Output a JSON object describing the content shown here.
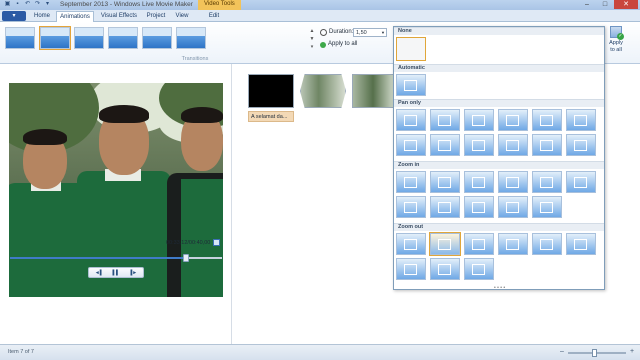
{
  "window": {
    "title": "September 2013 - Windows Live Movie Maker",
    "contextual_group": "Video Tools",
    "controls": {
      "minimize": "–",
      "maximize": "□",
      "close": "✕"
    }
  },
  "quick_access": [
    "save-icon",
    "undo-icon",
    "redo-icon"
  ],
  "tabs": {
    "file": "▾",
    "items": [
      "Home",
      "Animations",
      "Visual Effects",
      "Project",
      "View",
      "Edit"
    ],
    "active": "Animations"
  },
  "ribbon": {
    "transitions_group_label": "Transitions",
    "duration_label": "Duration:",
    "duration_value": "1,50",
    "apply_to_all_label": "Apply to all",
    "apply_to_all_big_label_1": "Apply",
    "apply_to_all_big_label_2": "to all",
    "gallery_scroll": "▲ ▼ ▾"
  },
  "preview": {
    "timecode": "00:33,12/00:40,00",
    "progress": 0.83,
    "controls": {
      "prev": "◄▌",
      "play": "▌▌",
      "next": "▐►"
    }
  },
  "storyboard": {
    "caption": "A selamat da..."
  },
  "animation_dropdown": {
    "sections": [
      {
        "title": "None",
        "count": 1
      },
      {
        "title": "Automatic",
        "count": 1
      },
      {
        "title": "Pan only",
        "count": 12
      },
      {
        "title": "Zoom in",
        "count": 11
      },
      {
        "title": "Zoom out",
        "count": 9
      }
    ],
    "hovered": "Zoom out item 2",
    "grip": "• • • •"
  },
  "status": {
    "text": "Item 7 of 7",
    "zoom_minus": "–",
    "zoom_plus": "+",
    "zoom_level": 0.45
  }
}
